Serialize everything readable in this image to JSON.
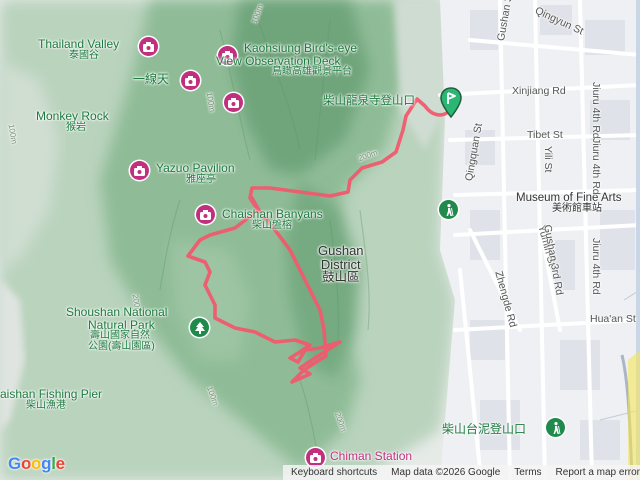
{
  "map": {
    "labels": {
      "thailand_valley": {
        "en": "Thailand Valley",
        "zh": "泰國谷"
      },
      "birds_eye": {
        "en1": "Kaohsiung Bird's-eye",
        "en2": "View Observation Deck",
        "zh": "鳥瞰高雄觀景平台"
      },
      "yixiantian": "一線天",
      "monkey_rock": {
        "en": "Monkey Rock",
        "zh": "猴岩"
      },
      "yazuo": {
        "en": "Yazuo Pavilion",
        "zh": "雅座亭"
      },
      "chaishan_banyans": {
        "en": "Chaishan Banyans",
        "zh": "柴山盤榕"
      },
      "longquan_temple": "柴山龍泉寺登山口",
      "gushan": {
        "en1": "Gushan",
        "en2": "District",
        "zh": "鼓山區"
      },
      "shoushan": {
        "en1": "Shoushan National",
        "en2": "Natural Park",
        "zh1": "壽山國家自然",
        "zh2": "公園(壽山園區)"
      },
      "fishing_pier": {
        "en": "aishan Fishing Pier",
        "zh": "柴山漁港"
      },
      "chiman": "Chiman Station",
      "mofa": {
        "en": "Museum of Fine Arts",
        "zh": "美術館車站"
      },
      "taini": "柴山台泥登山口"
    },
    "streets": {
      "gushan3_top": "Gushan 3rd Rd",
      "qingyun": "Qingyun St",
      "xinjiang": "Xinjiang Rd",
      "jiuru4_top": "Jiuru 4th Rd",
      "tibet": "Tibet St",
      "yiili": "Yili St",
      "qingquan": "Qingquan St",
      "jiuru4_mid": "Jiuru 4th Rd",
      "yumin": "Yumin St",
      "gushan3_mid": "Gushan 3rd Rd",
      "jiuru4_low": "Jiuru 4th Rd",
      "zhengde": "Zhengde Rd",
      "huaan": "Hua'an St"
    },
    "contours": [
      "100m",
      "200m",
      "100m",
      "200m",
      "100m",
      "200m",
      "100m"
    ],
    "icons": [
      "camera-icon",
      "tree-icon",
      "hiker-icon",
      "location-pin-icon"
    ]
  },
  "footer": {
    "logo": "Google",
    "shortcuts": "Keyboard shortcuts",
    "mapdata": "Map data ©2026 Google",
    "terms": "Terms",
    "report": "Report a map error"
  },
  "colors": {
    "route": "#f05a6e",
    "pin": "#2bb673",
    "poi": "#c0307f",
    "park_green": "#1f8a4c"
  }
}
